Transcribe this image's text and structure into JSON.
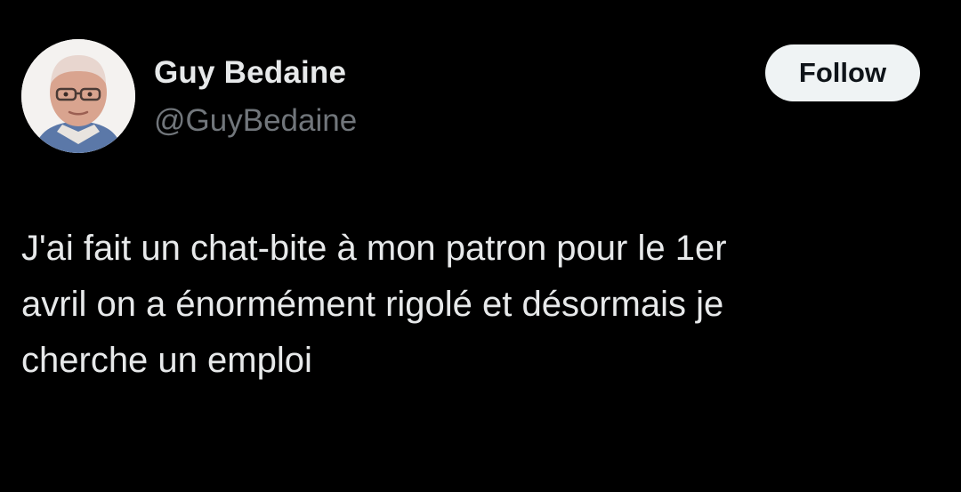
{
  "author": {
    "display_name": "Guy Bedaine",
    "handle": "@GuyBedaine",
    "avatar_icon": "user-avatar-photo"
  },
  "follow_button": {
    "label": "Follow"
  },
  "tweet": {
    "text_lines": [
      "J'ai fait un chat-bite à mon patron pour le 1er",
      "avril on a énormément rigolé et désormais je",
      "cherche un emploi"
    ]
  },
  "colors": {
    "background": "#000000",
    "primary_text": "#e7e9ea",
    "secondary_text": "#71767b",
    "follow_bg": "#eff3f4",
    "follow_text": "#0f1419"
  }
}
